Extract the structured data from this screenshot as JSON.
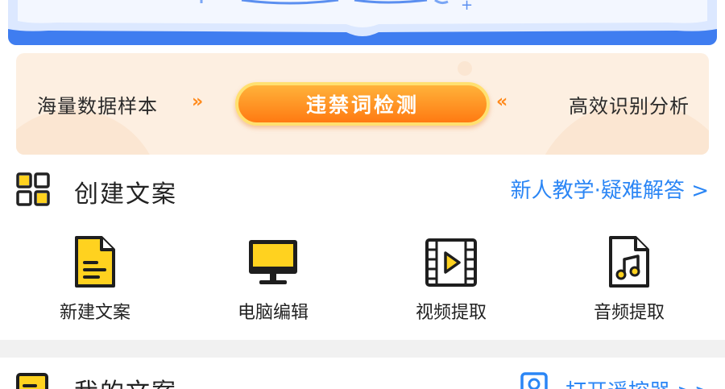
{
  "banner": {
    "note": ""
  },
  "promo": {
    "left_text": "海量数据样本",
    "button_label": "违禁词检测",
    "right_text": "高效识别分析",
    "chevron_left": "»",
    "chevron_right": "«"
  },
  "create": {
    "title": "创建文案",
    "help_link": "新人教学·疑难解答 >",
    "tools": [
      {
        "label": "新建文案",
        "icon": "new-document-icon"
      },
      {
        "label": "电脑编辑",
        "icon": "monitor-icon"
      },
      {
        "label": "视频提取",
        "icon": "video-icon"
      },
      {
        "label": "音频提取",
        "icon": "audio-file-icon"
      }
    ]
  },
  "my_docs": {
    "title": "我的文案",
    "remote_link": "打开遥控器 >>"
  },
  "colors": {
    "accent_blue": "#2b86f5",
    "accent_orange": "#ff7a12",
    "icon_yellow": "#ffd21f"
  }
}
